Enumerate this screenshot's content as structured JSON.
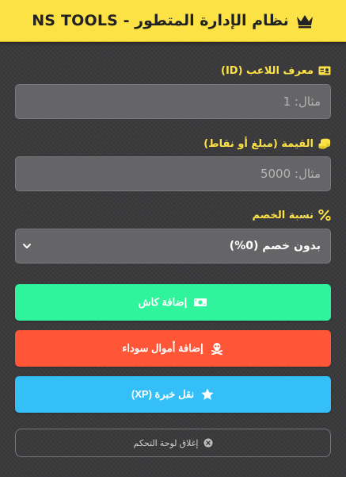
{
  "header": {
    "title": "نظام الإدارة المتطور - NS TOOLS",
    "icon": "crown-icon",
    "background": "#fde246"
  },
  "player_id": {
    "label": "معرف اللاعب (ID)",
    "icon": "id-card-icon",
    "placeholder": "مثال: 1",
    "value": ""
  },
  "amount": {
    "label": "القيمة (مبلغ أو نقاط)",
    "icon": "coins-icon",
    "placeholder": "مثال: 5000",
    "value": ""
  },
  "discount": {
    "label": "نسبة الخصم",
    "icon": "percent-icon",
    "selected": "بدون خصم (0%)"
  },
  "actions": {
    "add_cash": {
      "label": "إضافة كاش",
      "icon": "money-bill-icon",
      "color": "#2ff49c"
    },
    "add_black_money": {
      "label": "إضافة أموال سوداء",
      "icon": "skull-crossbones-icon",
      "color": "#ff5637"
    },
    "transfer_xp": {
      "label": "نقل خبرة (XP)",
      "icon": "star-icon",
      "color": "#34bff9"
    }
  },
  "close_panel": {
    "label": "إغلاق لوحة التحكم",
    "icon": "close-circle-icon"
  },
  "colors": {
    "accent": "#fde246",
    "background": "#3a3a3c",
    "input_bg": "#656567"
  }
}
